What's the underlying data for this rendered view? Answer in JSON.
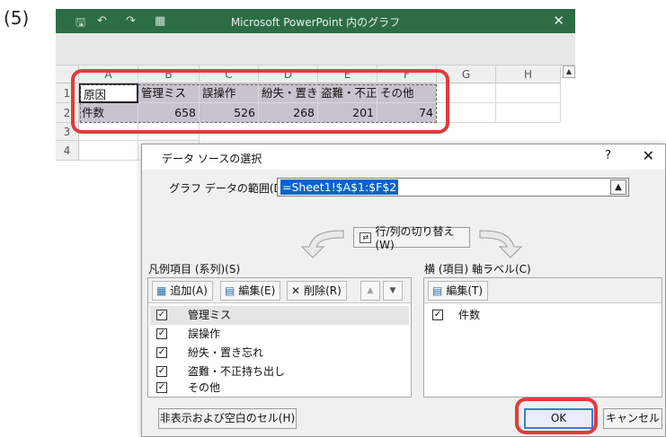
{
  "step_label": "(5)",
  "excel": {
    "title": "Microsoft PowerPoint 内のグラフ",
    "quick_access": [
      "🖫",
      "↶",
      "↷",
      "▦"
    ],
    "close": "✕",
    "columns": [
      "A",
      "B",
      "C",
      "D",
      "E",
      "F",
      "G",
      "H"
    ],
    "rows": [
      "1",
      "2",
      "3",
      "4"
    ],
    "row1": [
      "原因",
      "管理ミス",
      "誤操作",
      "紛失・置き",
      "盗難・不正",
      "その他"
    ],
    "row2": [
      "件数",
      "658",
      "526",
      "268",
      "201",
      "74"
    ]
  },
  "dialog": {
    "title": "データ ソースの選択",
    "help": "?",
    "close": "✕",
    "range_label": "グラフ データの範囲(D):",
    "range_value": "=Sheet1!$A$1:$F$2",
    "switch_label": "行/列の切り替え(W)",
    "legend_label": "凡例項目 (系列)(S)",
    "legend_toolbar": {
      "add": "追加(A)",
      "edit": "編集(E)",
      "delete": "削除(R)",
      "up": "▲",
      "down": "▼"
    },
    "series": [
      "管理ミス",
      "誤操作",
      "紛失・置き忘れ",
      "盗難・不正持ち出し",
      "その他"
    ],
    "axis_label": "横 (項目) 軸ラベル(C)",
    "axis_edit": "編集(T)",
    "axis_items": [
      "件数"
    ],
    "hidden_cells": "非表示および空白のセル(H)",
    "ok": "OK",
    "cancel": "キャンセル"
  },
  "colors": {
    "excel_title": "#2d6d45",
    "highlight": "#e13b3b",
    "selection": "#0a64c9"
  }
}
